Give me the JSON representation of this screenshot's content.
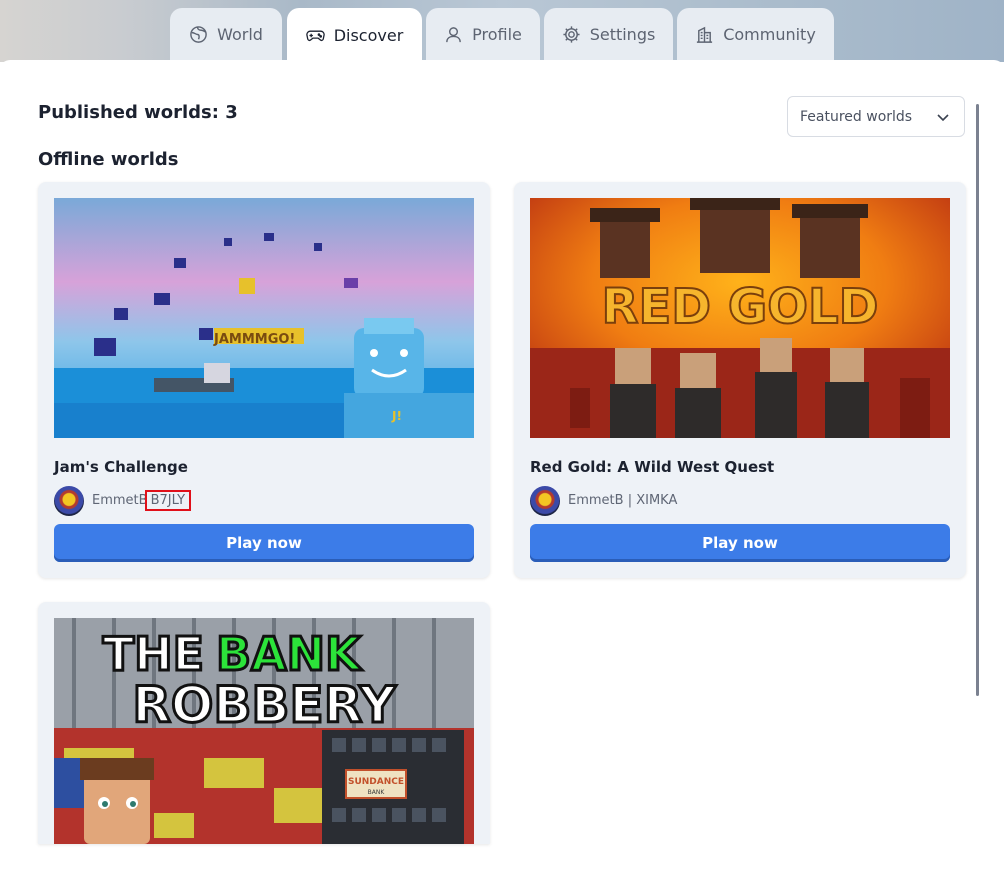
{
  "tabs": [
    {
      "label": "World",
      "icon": "globe-icon"
    },
    {
      "label": "Discover",
      "icon": "gamepad-icon",
      "active": true
    },
    {
      "label": "Profile",
      "icon": "user-icon"
    },
    {
      "label": "Settings",
      "icon": "gear-icon"
    },
    {
      "label": "Community",
      "icon": "buildings-icon"
    }
  ],
  "header": {
    "published": "Published worlds: 3",
    "offline": "Offline worlds"
  },
  "filter": {
    "selected": "Featured worlds"
  },
  "worlds": [
    {
      "title": "Jam's Challenge",
      "author": "EmmetB",
      "code": "B7JLY",
      "button": "Play now"
    },
    {
      "title": "Red Gold: A Wild West Quest",
      "author": "EmmetB",
      "code": "XIMKA",
      "button": "Play now"
    },
    {
      "thumb_line1a": "THE",
      "thumb_line1b": "BANK",
      "thumb_line2": "ROBBERY",
      "thumb_sign": "SUNDANCE",
      "thumb_sign2": "BANK"
    }
  ],
  "thumb_text": {
    "red_gold": "RED GOLD",
    "jam_sign": "JAMMMGO!",
    "jam_badge": "J!"
  },
  "colors": {
    "accent": "#3c7ce8",
    "card_bg": "#eef2f7",
    "highlight": "#e0101a"
  }
}
